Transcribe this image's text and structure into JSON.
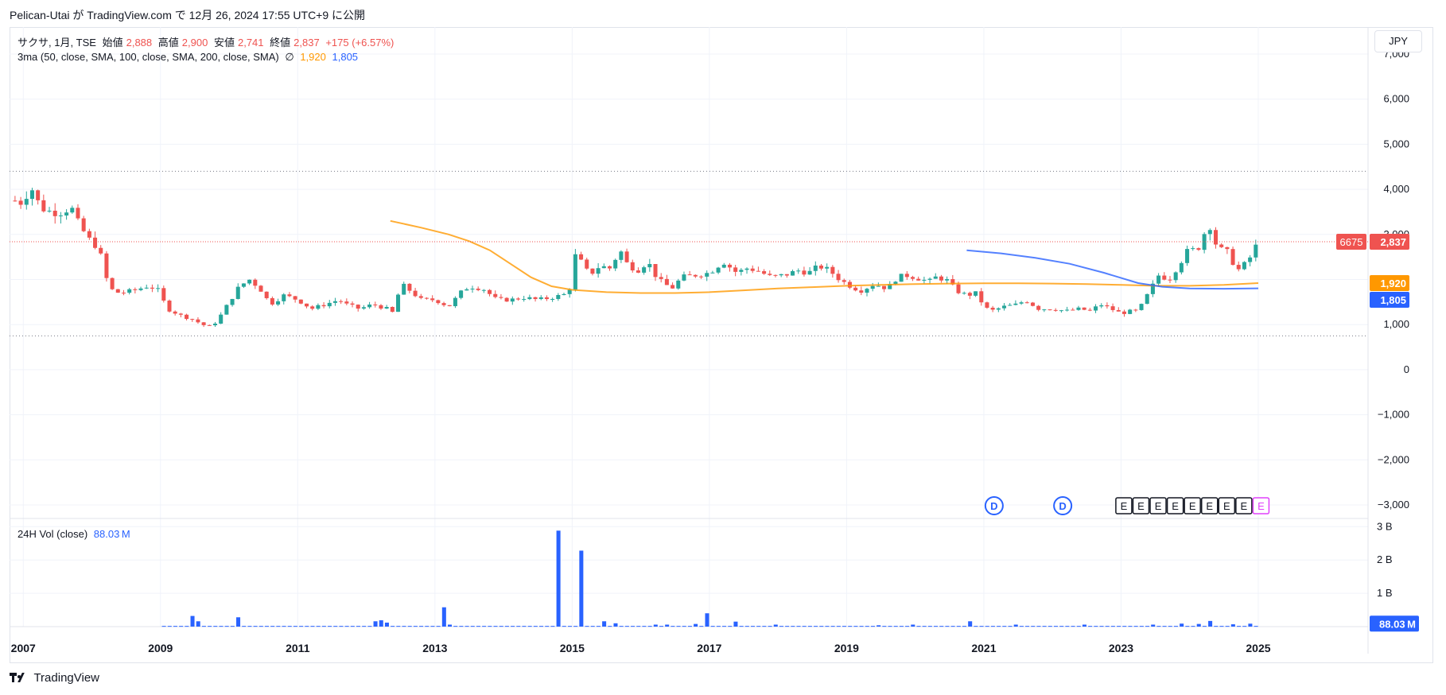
{
  "header": {
    "publish_info": "Pelican-Utai が TradingView.com で 12月 26, 2024 17:55 UTC+9 に公開"
  },
  "legend": {
    "symbol": "サクサ, 1月, TSE",
    "open_label": "始値",
    "open": "2,888",
    "high_label": "高値",
    "high": "2,900",
    "low_label": "安値",
    "low": "2,741",
    "close_label": "終値",
    "close": "2,837",
    "change": "+175 (+6.57%)",
    "ma_label": "3ma (50, close, SMA, 100, close, SMA, 200, close, SMA)",
    "ma_empty": "∅",
    "ma1_value": "1,920",
    "ma2_value": "1,805",
    "vol_label": "24H Vol (close)",
    "vol_value": "88.03 M"
  },
  "currency": "JPY",
  "footer": {
    "brand": "TradingView"
  },
  "colors": {
    "up": "#26a69a",
    "down": "#ef5350",
    "ma1": "#ff9800",
    "ma2": "#2962ff",
    "volume": "#2962ff",
    "dotted_level": "#787b86",
    "price_line": "#ef5350"
  },
  "chart_data": {
    "type": "candlestick",
    "timeframe": "1M",
    "y_ticks": [
      "7,000",
      "6,000",
      "5,000",
      "4,000",
      "3,000",
      "2,000",
      "1,000",
      "0",
      "−1,000",
      "−2,000",
      "−3,000"
    ],
    "y_tick_values": [
      7000,
      6000,
      5000,
      4000,
      3000,
      2000,
      1000,
      0,
      -1000,
      -2000,
      -3000
    ],
    "ylim": [
      -3300,
      7600
    ],
    "x_ticks": [
      "2007",
      "2009",
      "2011",
      "2013",
      "2015",
      "2017",
      "2019",
      "2021",
      "2023",
      "2025"
    ],
    "x_tick_values": [
      2007,
      2009,
      2011,
      2013,
      2015,
      2017,
      2019,
      2021,
      2023,
      2025
    ],
    "xlim": [
      2006.8,
      2026.6
    ],
    "horizontal_levels": [
      4400,
      750
    ],
    "last_price": {
      "value": 2837,
      "label": "2,837",
      "countdown": "6675"
    },
    "ma_labels": [
      {
        "value": 1920,
        "label": "1,920"
      },
      {
        "value": 1805,
        "label": "1,805"
      }
    ],
    "monthly_close_anchors": [
      [
        2006.88,
        3750
      ],
      [
        2007.0,
        3700
      ],
      [
        2007.1,
        4100
      ],
      [
        2007.25,
        3600
      ],
      [
        2007.4,
        3500
      ],
      [
        2007.55,
        3500
      ],
      [
        2007.7,
        3600
      ],
      [
        2007.8,
        3250
      ],
      [
        2007.95,
        2900
      ],
      [
        2008.1,
        2700
      ],
      [
        2008.25,
        1800
      ],
      [
        2008.4,
        1700
      ],
      [
        2008.6,
        1750
      ],
      [
        2008.8,
        1850
      ],
      [
        2008.95,
        1800
      ],
      [
        2009.1,
        1350
      ],
      [
        2009.3,
        1200
      ],
      [
        2009.5,
        1100
      ],
      [
        2009.6,
        1000
      ],
      [
        2009.75,
        950
      ],
      [
        2009.9,
        1250
      ],
      [
        2010.0,
        1500
      ],
      [
        2010.15,
        1850
      ],
      [
        2010.3,
        2000
      ],
      [
        2010.45,
        1800
      ],
      [
        2010.6,
        1450
      ],
      [
        2010.8,
        1650
      ],
      [
        2011.0,
        1550
      ],
      [
        2011.2,
        1350
      ],
      [
        2011.4,
        1450
      ],
      [
        2011.6,
        1550
      ],
      [
        2011.7,
        1450
      ],
      [
        2011.9,
        1350
      ],
      [
        2012.1,
        1450
      ],
      [
        2012.3,
        1350
      ],
      [
        2012.4,
        1250
      ],
      [
        2012.5,
        1900
      ],
      [
        2012.6,
        1800
      ],
      [
        2012.8,
        1550
      ],
      [
        2013.0,
        1550
      ],
      [
        2013.2,
        1400
      ],
      [
        2013.4,
        1750
      ],
      [
        2013.5,
        1850
      ],
      [
        2013.7,
        1800
      ],
      [
        2013.9,
        1550
      ],
      [
        2014.1,
        1550
      ],
      [
        2014.3,
        1600
      ],
      [
        2014.5,
        1550
      ],
      [
        2014.7,
        1600
      ],
      [
        2014.85,
        1650
      ],
      [
        2014.95,
        1700
      ],
      [
        2015.05,
        2550
      ],
      [
        2015.15,
        2350
      ],
      [
        2015.25,
        2100
      ],
      [
        2015.4,
        2300
      ],
      [
        2015.55,
        2250
      ],
      [
        2015.7,
        2650
      ],
      [
        2015.8,
        2350
      ],
      [
        2015.95,
        2200
      ],
      [
        2016.1,
        2400
      ],
      [
        2016.25,
        2000
      ],
      [
        2016.45,
        1800
      ],
      [
        2016.6,
        2050
      ],
      [
        2016.8,
        2100
      ],
      [
        2017.0,
        2150
      ],
      [
        2017.2,
        2400
      ],
      [
        2017.4,
        2150
      ],
      [
        2017.55,
        2250
      ],
      [
        2017.7,
        2200
      ],
      [
        2017.9,
        2050
      ],
      [
        2018.1,
        2100
      ],
      [
        2018.3,
        2200
      ],
      [
        2018.45,
        2150
      ],
      [
        2018.6,
        2300
      ],
      [
        2018.75,
        2200
      ],
      [
        2018.9,
        2000
      ],
      [
        2019.0,
        1900
      ],
      [
        2019.2,
        1750
      ],
      [
        2019.4,
        1900
      ],
      [
        2019.6,
        1800
      ],
      [
        2019.7,
        2000
      ],
      [
        2019.85,
        2100
      ],
      [
        2020.0,
        2050
      ],
      [
        2020.2,
        1950
      ],
      [
        2020.3,
        2050
      ],
      [
        2020.45,
        2000
      ],
      [
        2020.6,
        1750
      ],
      [
        2020.75,
        1650
      ],
      [
        2020.9,
        1700
      ],
      [
        2021.0,
        1400
      ],
      [
        2021.1,
        1300
      ],
      [
        2021.3,
        1400
      ],
      [
        2021.5,
        1450
      ],
      [
        2021.6,
        1550
      ],
      [
        2021.8,
        1350
      ],
      [
        2022.0,
        1350
      ],
      [
        2022.2,
        1300
      ],
      [
        2022.4,
        1350
      ],
      [
        2022.55,
        1300
      ],
      [
        2022.7,
        1450
      ],
      [
        2022.85,
        1350
      ],
      [
        2023.0,
        1250
      ],
      [
        2023.15,
        1300
      ],
      [
        2023.25,
        1300
      ],
      [
        2023.4,
        1700
      ],
      [
        2023.55,
        2100
      ],
      [
        2023.7,
        2000
      ],
      [
        2023.85,
        2350
      ],
      [
        2024.0,
        2700
      ],
      [
        2024.1,
        2600
      ],
      [
        2024.2,
        3000
      ],
      [
        2024.3,
        3200
      ],
      [
        2024.4,
        2700
      ],
      [
        2024.55,
        2600
      ],
      [
        2024.7,
        2200
      ],
      [
        2024.85,
        2400
      ],
      [
        2025.0,
        2837
      ]
    ],
    "ma_series": [
      {
        "length": 50,
        "color": "#ff9800",
        "points": [
          [
            2012.35,
            3300
          ],
          [
            2012.8,
            3150
          ],
          [
            2013.2,
            3000
          ],
          [
            2013.5,
            2850
          ],
          [
            2013.8,
            2650
          ],
          [
            2014.1,
            2350
          ],
          [
            2014.4,
            2050
          ],
          [
            2014.7,
            1850
          ],
          [
            2015.0,
            1770
          ],
          [
            2015.5,
            1720
          ],
          [
            2016.0,
            1700
          ],
          [
            2016.5,
            1700
          ],
          [
            2017.0,
            1720
          ],
          [
            2017.5,
            1760
          ],
          [
            2018.0,
            1800
          ],
          [
            2018.5,
            1830
          ],
          [
            2019.0,
            1860
          ],
          [
            2019.5,
            1880
          ],
          [
            2020.0,
            1900
          ],
          [
            2020.5,
            1910
          ],
          [
            2021.0,
            1915
          ],
          [
            2021.5,
            1918
          ],
          [
            2022.0,
            1910
          ],
          [
            2022.5,
            1900
          ],
          [
            2023.0,
            1880
          ],
          [
            2023.5,
            1860
          ],
          [
            2024.0,
            1860
          ],
          [
            2024.5,
            1880
          ],
          [
            2025.0,
            1920
          ]
        ]
      },
      {
        "length": 100,
        "color": "#2962ff",
        "points": [
          [
            2020.75,
            2650
          ],
          [
            2021.25,
            2580
          ],
          [
            2021.75,
            2480
          ],
          [
            2022.25,
            2350
          ],
          [
            2022.75,
            2150
          ],
          [
            2023.25,
            1920
          ],
          [
            2023.6,
            1840
          ],
          [
            2024.0,
            1800
          ],
          [
            2024.5,
            1795
          ],
          [
            2025.0,
            1805
          ]
        ]
      }
    ],
    "volume": {
      "y_ticks": [
        "3 B",
        "2 B",
        "1 B"
      ],
      "y_tick_values": [
        3000000000.0,
        2000000000.0,
        1000000000.0
      ],
      "ylim": [
        0,
        3150000000.0
      ],
      "last": {
        "value": 88030000,
        "label": "88.03 M"
      },
      "x_start": 2009.05,
      "baseline": 20000000,
      "spikes": [
        [
          2009.45,
          320000000
        ],
        [
          2009.55,
          160000000
        ],
        [
          2010.1,
          280000000
        ],
        [
          2012.1,
          160000000
        ],
        [
          2012.2,
          190000000
        ],
        [
          2012.3,
          120000000
        ],
        [
          2013.1,
          580000000
        ],
        [
          2013.2,
          60000000
        ],
        [
          2014.8,
          2880000000
        ],
        [
          2015.15,
          2280000000
        ],
        [
          2015.5,
          160000000
        ],
        [
          2015.6,
          100000000
        ],
        [
          2016.2,
          60000000
        ],
        [
          2016.4,
          60000000
        ],
        [
          2016.8,
          80000000
        ],
        [
          2017.0,
          400000000
        ],
        [
          2017.4,
          150000000
        ],
        [
          2018.0,
          60000000
        ],
        [
          2019.5,
          40000000
        ],
        [
          2020.0,
          60000000
        ],
        [
          2020.8,
          160000000
        ],
        [
          2021.5,
          60000000
        ],
        [
          2022.5,
          60000000
        ],
        [
          2023.5,
          60000000
        ],
        [
          2023.9,
          90000000
        ],
        [
          2024.1,
          80000000
        ],
        [
          2024.3,
          170000000
        ],
        [
          2024.6,
          70000000
        ],
        [
          2024.9,
          88030000
        ]
      ]
    },
    "events": [
      {
        "type": "dividend",
        "label": "D",
        "x": 2021.15
      },
      {
        "type": "dividend",
        "label": "D",
        "x": 2022.15
      },
      {
        "type": "earnings",
        "label": "E",
        "x": 2023.04
      },
      {
        "type": "earnings",
        "label": "E",
        "x": 2023.29
      },
      {
        "type": "earnings",
        "label": "E",
        "x": 2023.54
      },
      {
        "type": "earnings",
        "label": "E",
        "x": 2023.79
      },
      {
        "type": "earnings",
        "label": "E",
        "x": 2024.04
      },
      {
        "type": "earnings",
        "label": "E",
        "x": 2024.29
      },
      {
        "type": "earnings",
        "label": "E",
        "x": 2024.54
      },
      {
        "type": "earnings",
        "label": "E",
        "x": 2024.79
      },
      {
        "type": "earnings-upcoming",
        "label": "E",
        "x": 2025.04
      }
    ]
  }
}
